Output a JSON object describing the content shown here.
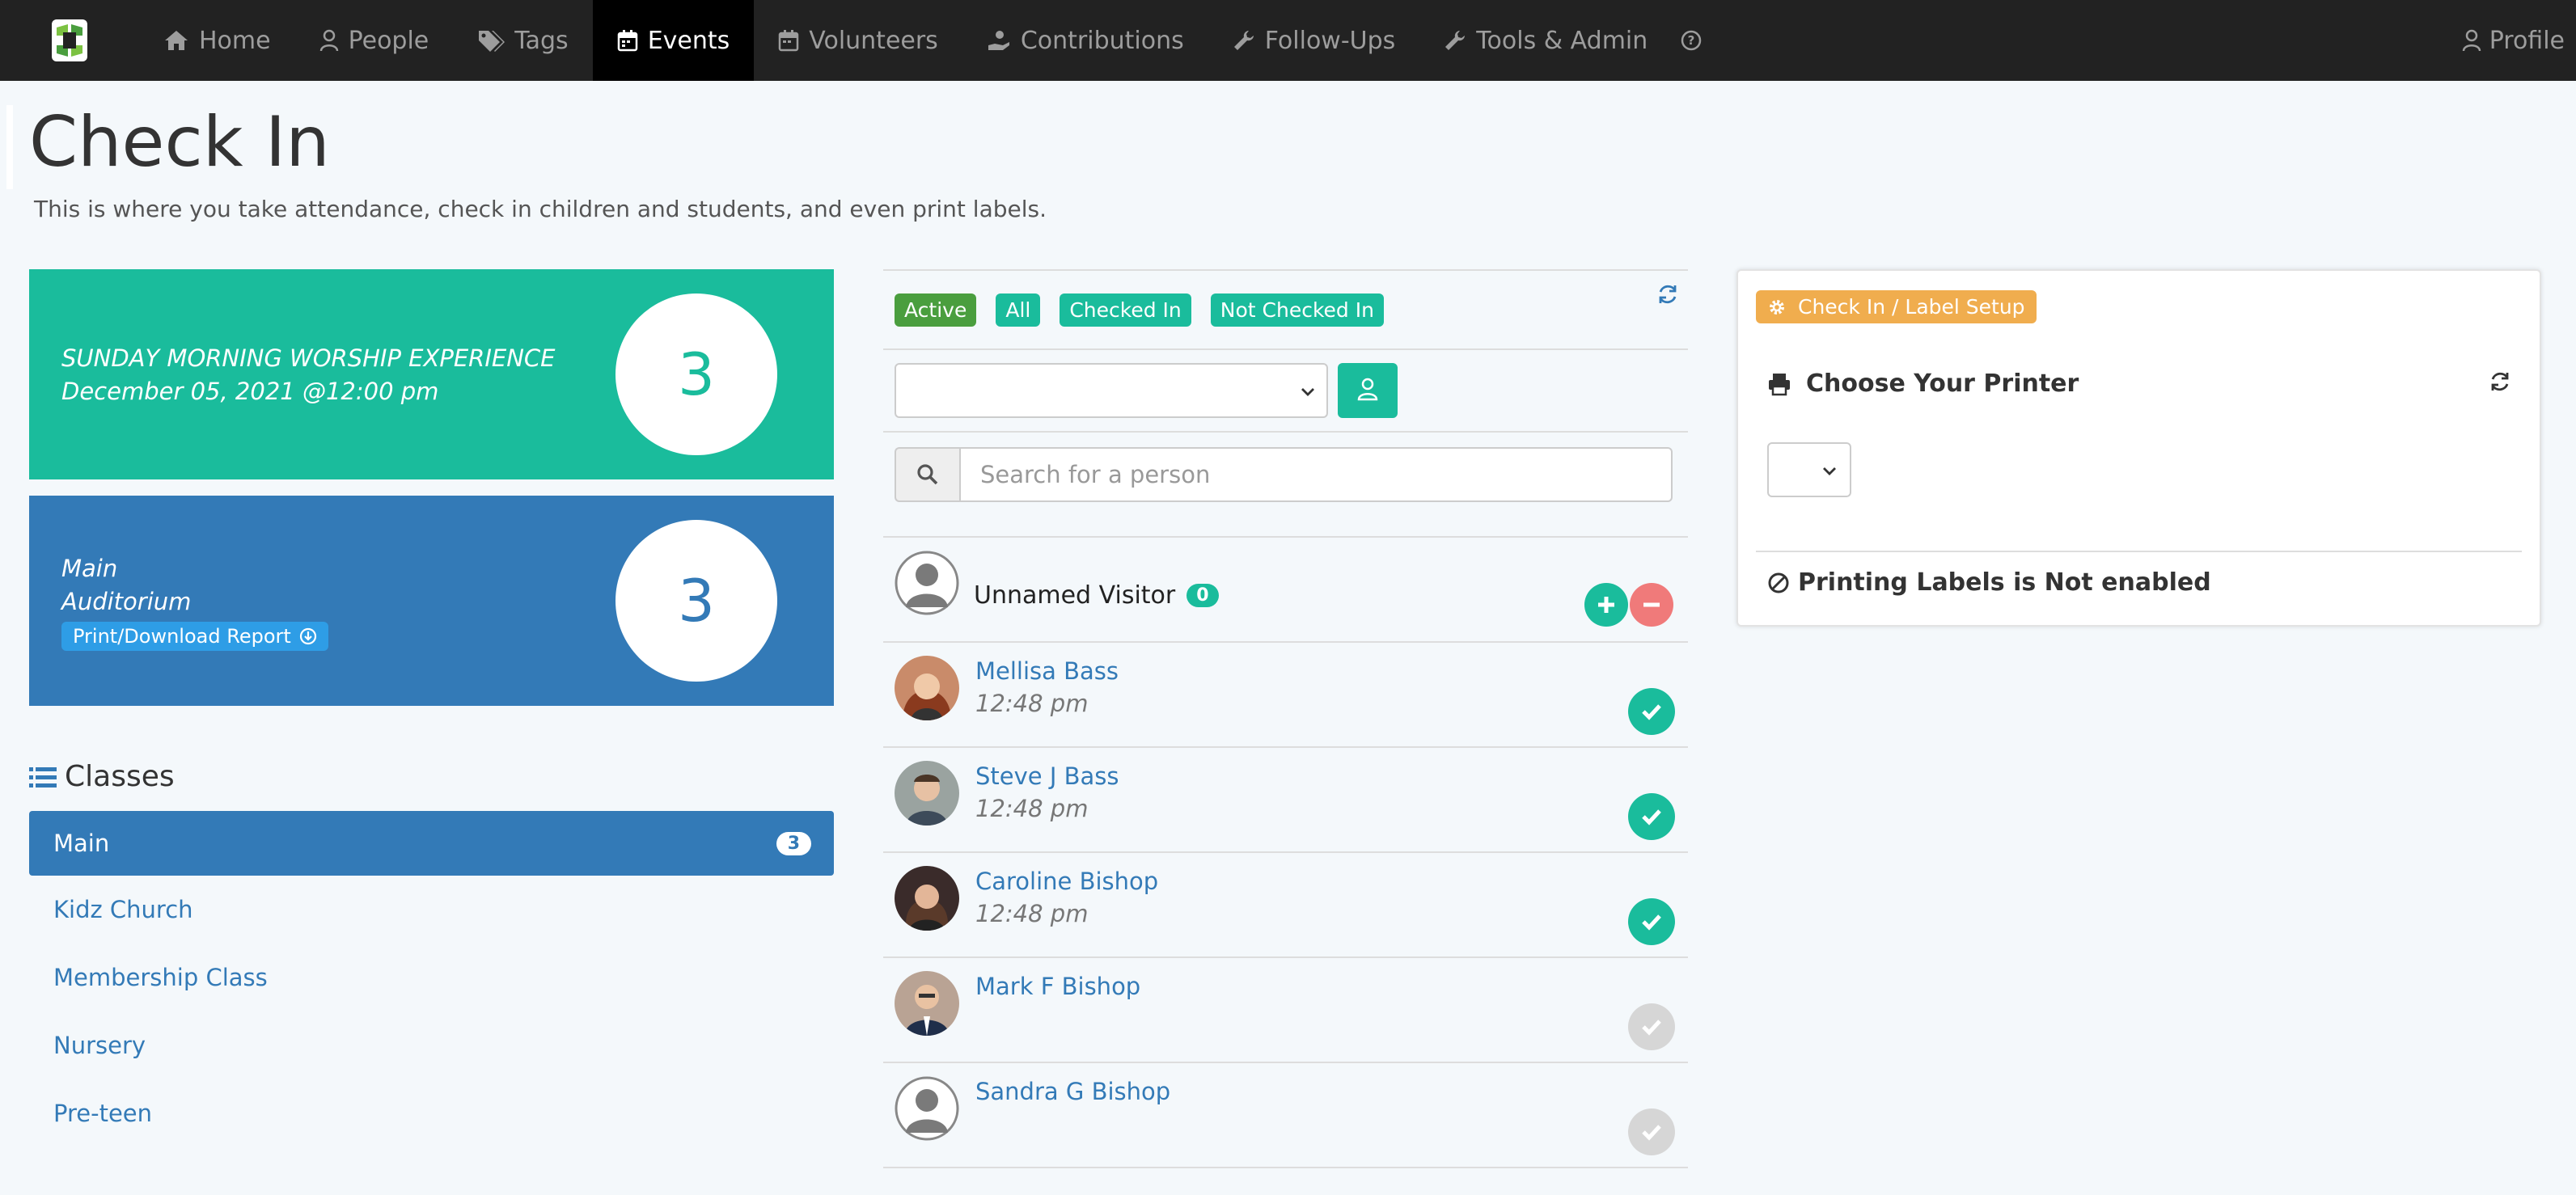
{
  "nav": {
    "items": [
      {
        "label": "Home",
        "icon": "home-icon"
      },
      {
        "label": "People",
        "icon": "user-icon"
      },
      {
        "label": "Tags",
        "icon": "tags-icon"
      },
      {
        "label": "Events",
        "icon": "calendar-icon",
        "active": true
      },
      {
        "label": "Volunteers",
        "icon": "calendar-icon"
      },
      {
        "label": "Contributions",
        "icon": "hand-coin-icon"
      },
      {
        "label": "Follow-Ups",
        "icon": "wrench-icon"
      },
      {
        "label": "Tools & Admin",
        "icon": "wrench-icon"
      }
    ],
    "profile": "Profile"
  },
  "header": {
    "title": "Check In",
    "subtitle": "This is where you take attendance, check in children and students, and even print labels."
  },
  "event": {
    "name": "SUNDAY MORNING WORSHIP EXPERIENCE",
    "date": "December 05, 2021 @12:00 pm",
    "count": "3"
  },
  "room": {
    "line1": "Main",
    "line2": "Auditorium",
    "report_label": "Print/Download Report",
    "count": "3"
  },
  "classes": {
    "heading": "Classes",
    "items": [
      {
        "label": "Main",
        "count": "3",
        "active": true
      },
      {
        "label": "Kidz Church"
      },
      {
        "label": "Membership Class"
      },
      {
        "label": "Nursery"
      },
      {
        "label": "Pre-teen"
      }
    ]
  },
  "filters": [
    "Active",
    "All",
    "Checked In",
    "Not Checked In"
  ],
  "search": {
    "placeholder": "Search for a person"
  },
  "visitor": {
    "label": "Unnamed Visitor",
    "count": "0"
  },
  "people": [
    {
      "name": "Mellisa Bass",
      "time": "12:48 pm",
      "checked": true
    },
    {
      "name": "Steve J Bass",
      "time": "12:48 pm",
      "checked": true
    },
    {
      "name": "Caroline Bishop",
      "time": "12:48 pm",
      "checked": true
    },
    {
      "name": "Mark F Bishop",
      "time": "",
      "checked": false
    },
    {
      "name": "Sandra G Bishop",
      "time": "",
      "checked": false
    }
  ],
  "setup": {
    "tag": "Check In / Label Setup",
    "printer_heading": "Choose Your Printer",
    "labels_status": "Printing Labels is Not enabled"
  },
  "colors": {
    "green": "#1abc9c",
    "blue": "#337ab7",
    "orange": "#f0ad4e",
    "nav": "#222222"
  }
}
